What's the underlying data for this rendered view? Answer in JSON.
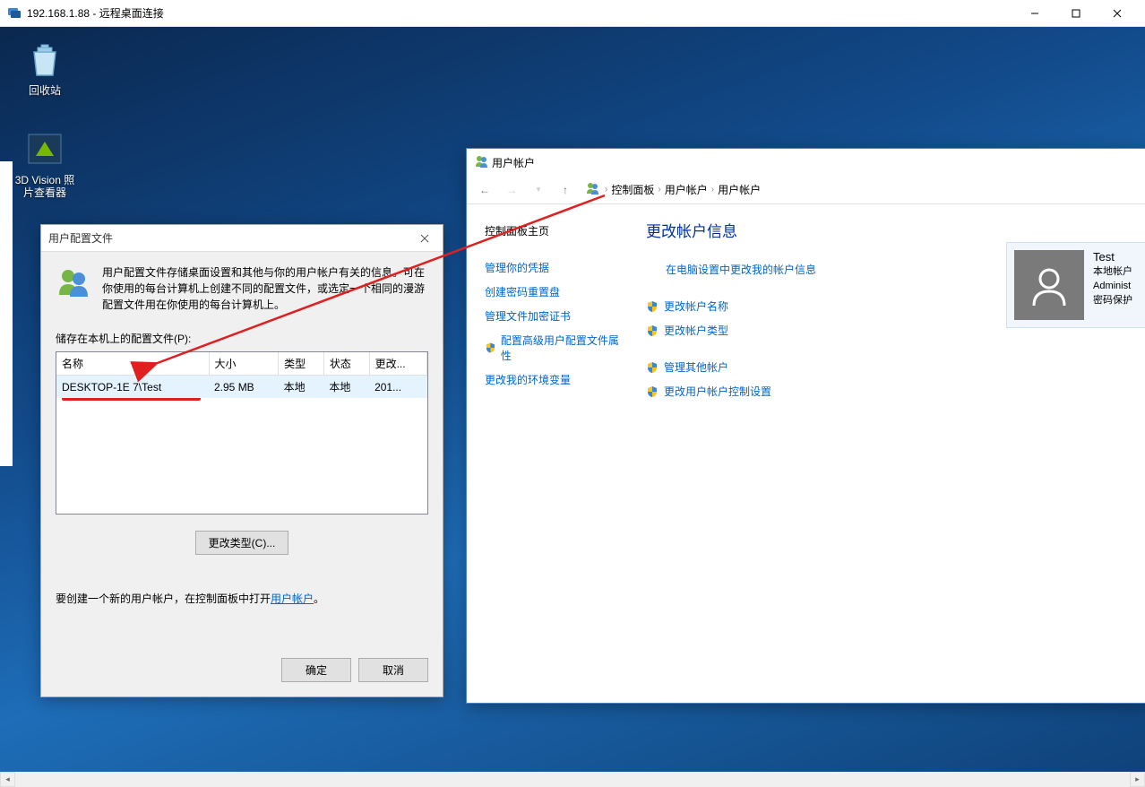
{
  "rdp": {
    "title": "192.168.1.88 - 远程桌面连接"
  },
  "desktop_icons": {
    "recycle": "回收站",
    "viewer": "3D Vision 照片查看器"
  },
  "profile_dialog": {
    "title": "用户配置文件",
    "info": "用户配置文件存储桌面设置和其他与你的用户帐户有关的信息。可在你使用的每台计算机上创建不同的配置文件，或选定一个相同的漫游配置文件用在你使用的每台计算机上。",
    "stored_label": "储存在本机上的配置文件(P):",
    "columns": {
      "name": "名称",
      "size": "大小",
      "type": "类型",
      "status": "状态",
      "changed": "更改..."
    },
    "row": {
      "name": "DESKTOP-1E       7\\Test",
      "size": "2.95 MB",
      "type": "本地",
      "status": "本地",
      "changed": "201..."
    },
    "change_type_btn": "更改类型(C)...",
    "create_prefix": "要创建一个新的用户帐户，在控制面板中打开",
    "create_link": "用户帐户",
    "create_suffix": "。",
    "ok": "确定",
    "cancel": "取消"
  },
  "accounts_window": {
    "title": "用户帐户",
    "breadcrumb": [
      "控制面板",
      "用户帐户",
      "用户帐户"
    ],
    "sidebar": {
      "home": "控制面板主页",
      "items": [
        "管理你的凭据",
        "创建密码重置盘",
        "管理文件加密证书",
        "配置高级用户配置文件属性",
        "更改我的环境变量"
      ]
    },
    "main": {
      "title": "更改帐户信息",
      "top_link": "在电脑设置中更改我的帐户信息",
      "group1": [
        "更改帐户名称",
        "更改帐户类型"
      ],
      "group2": [
        "管理其他帐户",
        "更改用户帐户控制设置"
      ]
    },
    "user": {
      "name": "Test",
      "line1": "本地帐户",
      "line2": "Administ",
      "line3": "密码保护"
    }
  }
}
